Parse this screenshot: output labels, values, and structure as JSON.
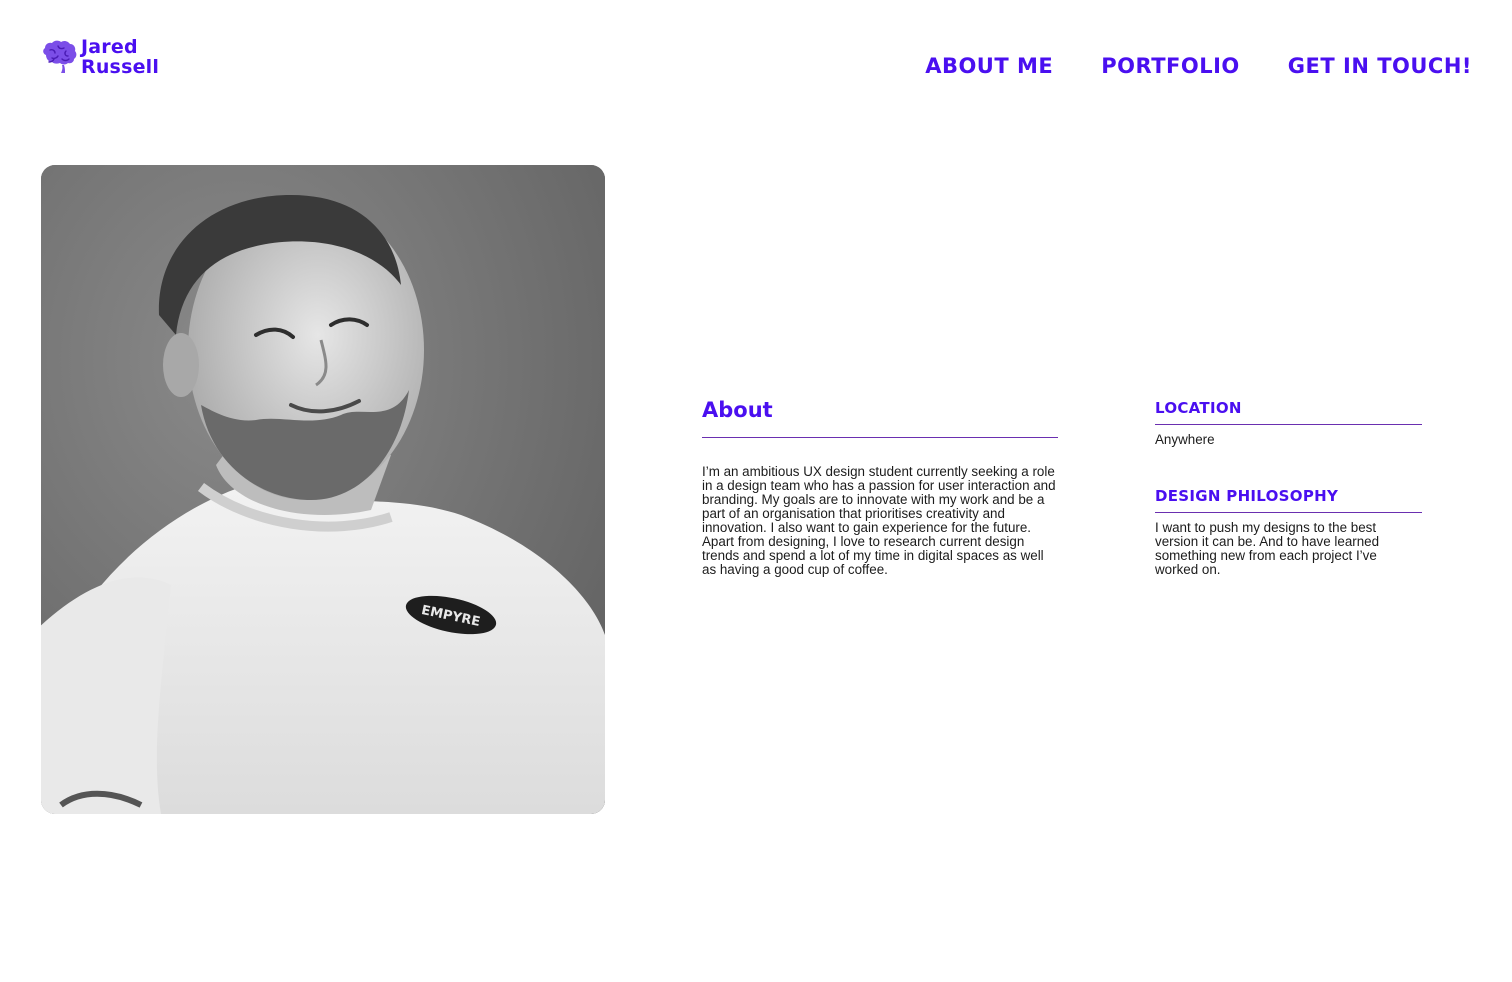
{
  "header": {
    "brand": {
      "first_name": "Jared",
      "last_name": "Russell",
      "logo_icon": "brain-icon"
    },
    "nav": [
      {
        "label": "ABOUT ME"
      },
      {
        "label": "PORTFOLIO"
      },
      {
        "label": "GET IN TOUCH!"
      }
    ]
  },
  "photo": {
    "shirt_text": "EMPYRE"
  },
  "about": {
    "heading": "About",
    "body": "I’m an ambitious UX design student currently seeking a role in a design team who has a passion for user interaction and branding. My goals are to innovate with my work and be a part of an organisation that prioritises creativity and innovation. I also want to gain experience for the future. Apart from designing, I love to research current design trends and spend a lot of my time in digital spaces as well as having a good cup of coffee."
  },
  "location": {
    "heading": "LOCATION",
    "value": "Anywhere"
  },
  "philosophy": {
    "heading": "DESIGN PHILOSOPHY",
    "text": "I want to push my designs to the best version it can be. And to have learned something new from each project I’ve worked on."
  },
  "colors": {
    "accent": "#4a0ff0",
    "rule": "#6a2fb0",
    "text": "#1c1c1c",
    "background": "#ffffff"
  }
}
